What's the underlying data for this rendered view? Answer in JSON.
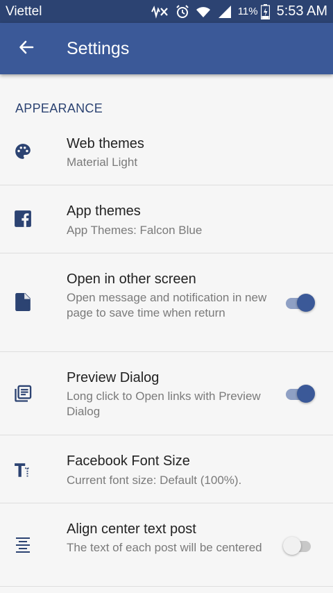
{
  "status_bar": {
    "carrier": "Viettel",
    "battery_percent": "11%",
    "time": "5:53 AM",
    "icons": [
      "mute-icon",
      "alarm-icon",
      "wifi-icon",
      "signal-icon",
      "battery-icon"
    ]
  },
  "app_bar": {
    "title": "Settings",
    "back_icon": "arrow-left-icon",
    "color": "#3b5998"
  },
  "section": {
    "header": "APPEARANCE"
  },
  "settings": [
    {
      "title": "Web themes",
      "summary": "Material Light",
      "icon": "palette-icon"
    },
    {
      "title": "App themes",
      "summary": "App Themes: Falcon Blue",
      "icon": "facebook-icon"
    },
    {
      "title": "Open in other screen",
      "summary": "Open message and notification in new page to save time when return",
      "icon": "file-icon",
      "toggle": "on"
    },
    {
      "title": "Preview Dialog",
      "summary": "Long click to Open links with Preview Dialog",
      "icon": "preview-list-icon",
      "toggle": "on"
    },
    {
      "title": "Facebook Font Size",
      "summary": "Current font size: Default (100%).",
      "icon": "text-size-icon"
    },
    {
      "title": "Align center text post",
      "summary": "The text of each post will be centered",
      "icon": "align-center-icon",
      "toggle": "off"
    }
  ],
  "colors": {
    "accent": "#3b5998",
    "status_bar": "#2c4372",
    "section_header": "#2c4372"
  }
}
